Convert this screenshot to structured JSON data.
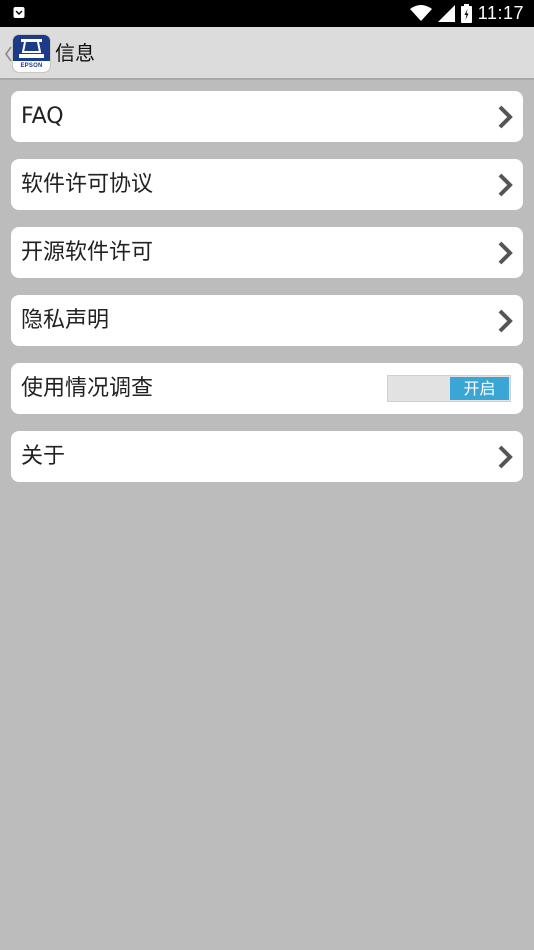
{
  "status_bar": {
    "time": "11:17",
    "icons": [
      "notification-icon",
      "wifi-icon",
      "cell-signal-icon",
      "battery-icon"
    ]
  },
  "app_bar": {
    "title": "信息",
    "logo_text": "EPSON",
    "back_icon": "chevron-left-icon"
  },
  "menu": {
    "items": [
      {
        "label": "FAQ",
        "control": "chevron"
      },
      {
        "label": "软件许可协议",
        "control": "chevron"
      },
      {
        "label": "开源软件许可",
        "control": "chevron"
      },
      {
        "label": "隐私声明",
        "control": "chevron"
      },
      {
        "label": "使用情况调查",
        "control": "toggle",
        "toggle_label": "开启"
      },
      {
        "label": "关于",
        "control": "chevron"
      }
    ]
  },
  "colors": {
    "background": "#bcbcbc",
    "app_bar": "#dcdcdc",
    "toggle_on": "#3aa6d6",
    "logo_blue": "#1b3a8a"
  }
}
